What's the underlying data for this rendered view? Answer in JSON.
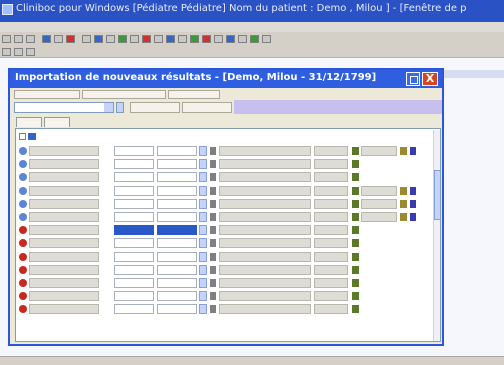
{
  "window": {
    "title": "Cliniboc pour Windows [Pédiatre Pédiatre]   Nom du patient : Demo , Milou ] - [Fenêtre de p"
  },
  "dialog": {
    "title": "Importation de nouveaux résultats - [Demo, Milou - 31/12/1799]",
    "close_label": "X"
  },
  "colors": {
    "main_titlebar": "#2a52c4",
    "dialog_titlebar": "#2f5fe0",
    "close_button": "#d8451e",
    "selected_field": "#2a58c8",
    "lavender_panel": "#c7c0ef"
  },
  "rows": [
    {
      "icon": "blue-circle-icon",
      "unit_dropdown": true,
      "field3": true,
      "trend": true,
      "flag": true
    },
    {
      "icon": "blue-circle-icon",
      "unit_dropdown": true,
      "field3": false,
      "trend": false,
      "flag": false
    },
    {
      "icon": "blue-circle-icon",
      "unit_dropdown": false,
      "field3": false,
      "trend": false,
      "flag": false
    },
    {
      "icon": "blue-circle-icon",
      "unit_dropdown": true,
      "field3": true,
      "trend": true,
      "flag": true
    },
    {
      "icon": "blue-circle-icon",
      "unit_dropdown": true,
      "field3": true,
      "trend": true,
      "flag": true
    },
    {
      "icon": "blue-circle-icon",
      "unit_dropdown": true,
      "field3": true,
      "trend": true,
      "flag": true
    },
    {
      "icon": "red-circle-icon",
      "unit_dropdown": false,
      "selected": true,
      "field3": false,
      "trend": false,
      "flag": false
    },
    {
      "icon": "red-circle-icon",
      "unit_dropdown": false,
      "field3": false,
      "trend": false,
      "flag": false
    },
    {
      "icon": "red-circle-icon",
      "unit_dropdown": false,
      "field3": false,
      "trend": false,
      "flag": false
    },
    {
      "icon": "red-circle-icon",
      "unit_dropdown": false,
      "field3": false,
      "trend": false,
      "flag": false
    },
    {
      "icon": "red-circle-icon",
      "unit_dropdown": false,
      "field3": false,
      "trend": false,
      "flag": false
    },
    {
      "icon": "red-circle-icon",
      "unit_dropdown": false,
      "field3": false,
      "trend": false,
      "flag": false
    },
    {
      "icon": "red-circle-icon",
      "unit_dropdown": false,
      "field3": false,
      "trend": false,
      "flag": false
    }
  ]
}
